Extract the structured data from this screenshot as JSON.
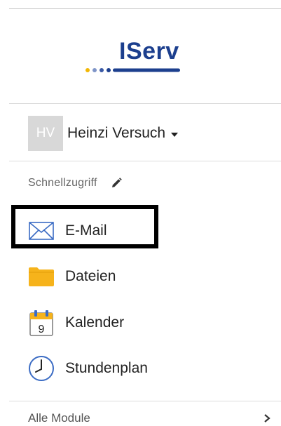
{
  "logo": {
    "text": "IServ",
    "brand_color": "#1c3f8e",
    "accent_color": "#f2b705"
  },
  "user": {
    "initials": "HV",
    "name": "Heinzi Versuch",
    "avatar_bg": "#d8d8d8"
  },
  "quick_access": {
    "label": "Schnellzugriff",
    "edit_icon": "pencil-icon",
    "items": [
      {
        "label": "E-Mail",
        "icon": "envelope-icon"
      },
      {
        "label": "Dateien",
        "icon": "folder-icon"
      },
      {
        "label": "Kalender",
        "icon": "calendar-icon",
        "calendar_day": "9"
      },
      {
        "label": "Stundenplan",
        "icon": "clock-icon"
      }
    ]
  },
  "all_modules": {
    "label": "Alle Module",
    "icon": "chevron-right-icon"
  },
  "colors": {
    "folder": "#f6b31b",
    "icon_blue": "#3b6cc4",
    "highlight_border": "#000000"
  }
}
